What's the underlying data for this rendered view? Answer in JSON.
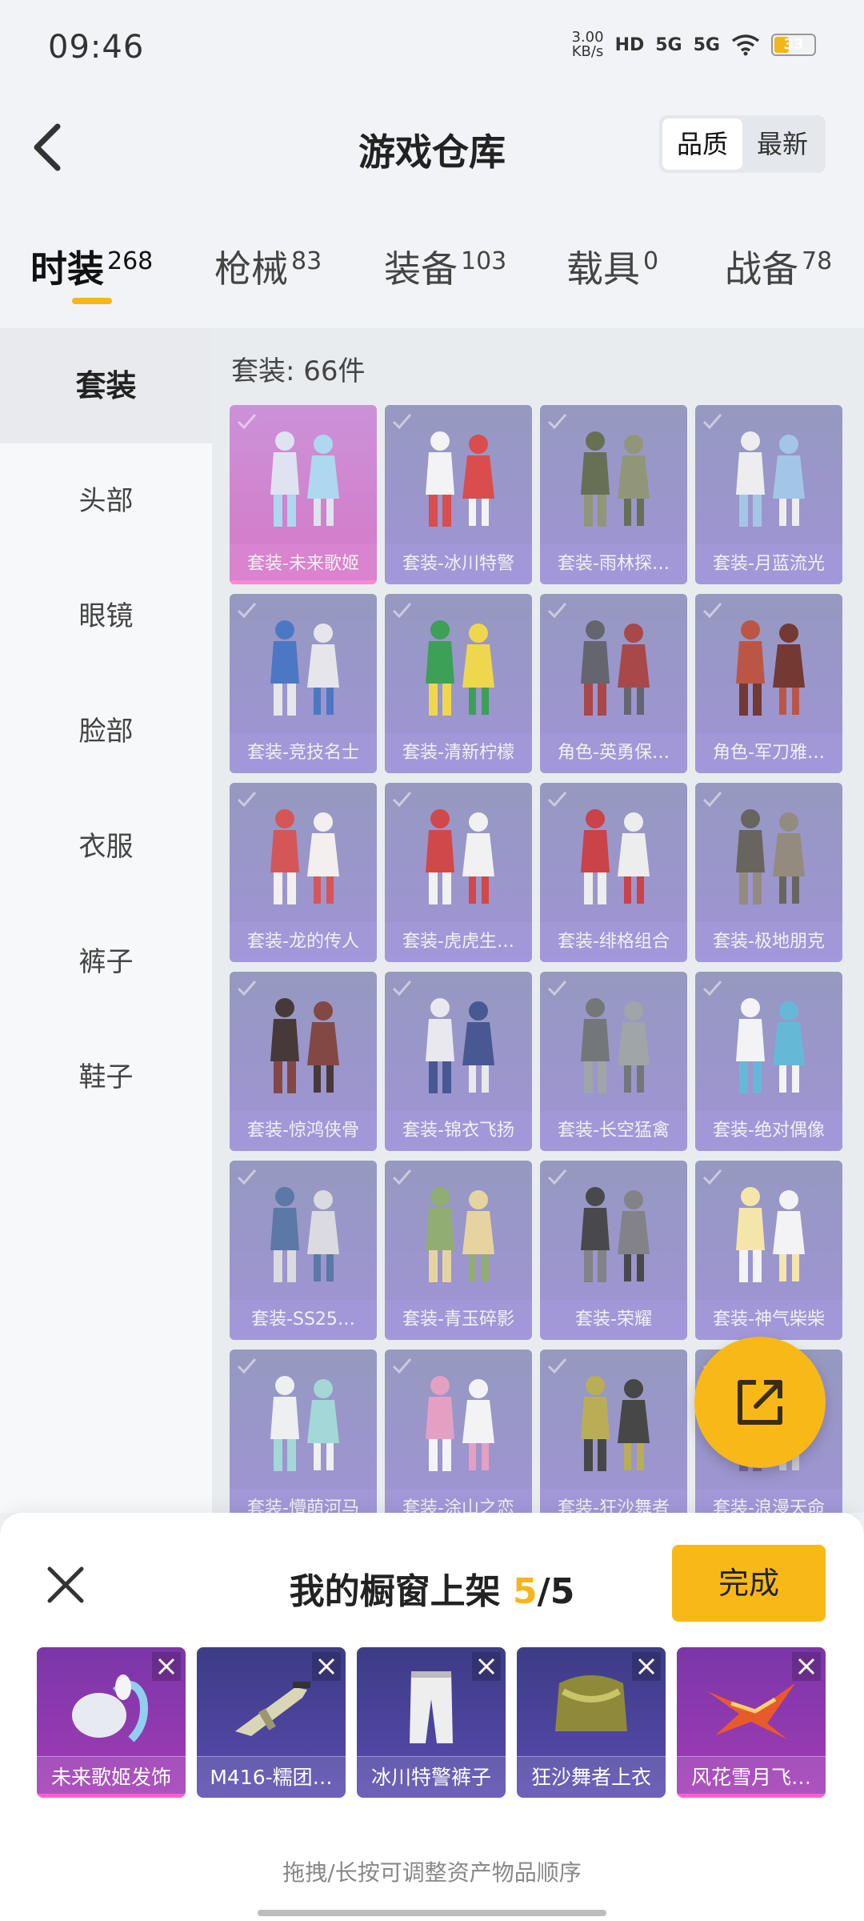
{
  "status_bar": {
    "time": "09:46",
    "net_speed": "3.00",
    "net_unit": "KB/s",
    "hd": "HD",
    "sim1": "5G",
    "sim2": "5G",
    "battery": "33"
  },
  "header": {
    "title": "游戏仓库",
    "sort_options": [
      "品质",
      "最新"
    ],
    "sort_active": "品质"
  },
  "tabs": [
    {
      "label": "时装",
      "count": "268"
    },
    {
      "label": "枪械",
      "count": "83"
    },
    {
      "label": "装备",
      "count": "103"
    },
    {
      "label": "载具",
      "count": "0"
    },
    {
      "label": "战备",
      "count": "78"
    }
  ],
  "sidebar": [
    "套装",
    "头部",
    "眼镜",
    "脸部",
    "衣服",
    "裤子",
    "鞋子"
  ],
  "section_label": "套装: 66件",
  "items": [
    "套装-未来歌姬",
    "套装-冰川特警",
    "套装-雨林探…",
    "套装-月蓝流光",
    "套装-竞技名士",
    "套装-清新柠檬",
    "角色-英勇保…",
    "角色-军刀雅…",
    "套装-龙的传人",
    "套装-虎虎生…",
    "套装-绯格组合",
    "套装-极地朋克",
    "套装-惊鸿侠骨",
    "套装-锦衣飞扬",
    "套装-长空猛禽",
    "套装-绝对偶像",
    "套装-SS25…",
    "套装-青玉碎影",
    "套装-荣耀",
    "套装-神气柴柴",
    "套装-懵萌河马",
    "套装-涂山之恋",
    "套装-狂沙舞者",
    "套装-浪漫天命"
  ],
  "sheet": {
    "title": "我的橱窗上架",
    "count_current": "5",
    "count_sep": "/5",
    "done_label": "完成",
    "shelf": [
      "未来歌姬发饰",
      "M416-糯团…",
      "冰川特警裤子",
      "狂沙舞者上衣",
      "风花雪月飞…"
    ],
    "hint": "拖拽/长按可调整资产物品顺序"
  },
  "colors": {
    "accent": "#f8b918",
    "card_purple": "#9a8cd4",
    "card_selected": "#d56fc3"
  }
}
